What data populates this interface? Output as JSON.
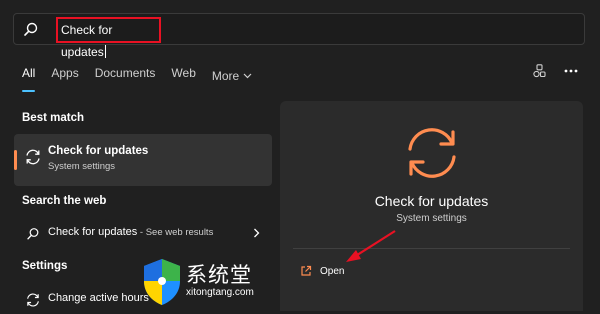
{
  "search": {
    "value": "Check for updates"
  },
  "tabs": [
    {
      "label": "All",
      "active": true
    },
    {
      "label": "Apps"
    },
    {
      "label": "Documents"
    },
    {
      "label": "Web"
    },
    {
      "label": "More"
    }
  ],
  "left": {
    "best_match_title": "Best match",
    "best_match_item": {
      "title": "Check for updates",
      "subtitle": "System settings",
      "icon": "sync-icon"
    },
    "search_web_title": "Search the web",
    "web_item": {
      "label": "Check for updates",
      "hint": " - See web results",
      "icon": "search-icon"
    },
    "settings_title": "Settings",
    "settings_item": {
      "label": "Change active hours",
      "icon": "sync-icon"
    }
  },
  "right": {
    "title": "Check for updates",
    "subtitle": "System settings",
    "open_label": "Open",
    "icon": "sync-icon"
  },
  "watermark": {
    "text": "系统堂",
    "url": "xitongtang.com"
  },
  "colors": {
    "accent": "#4cc2ff",
    "highlight_box": "#e81123",
    "sync_icon": "#ff8c50",
    "arrow": "#e81123"
  }
}
